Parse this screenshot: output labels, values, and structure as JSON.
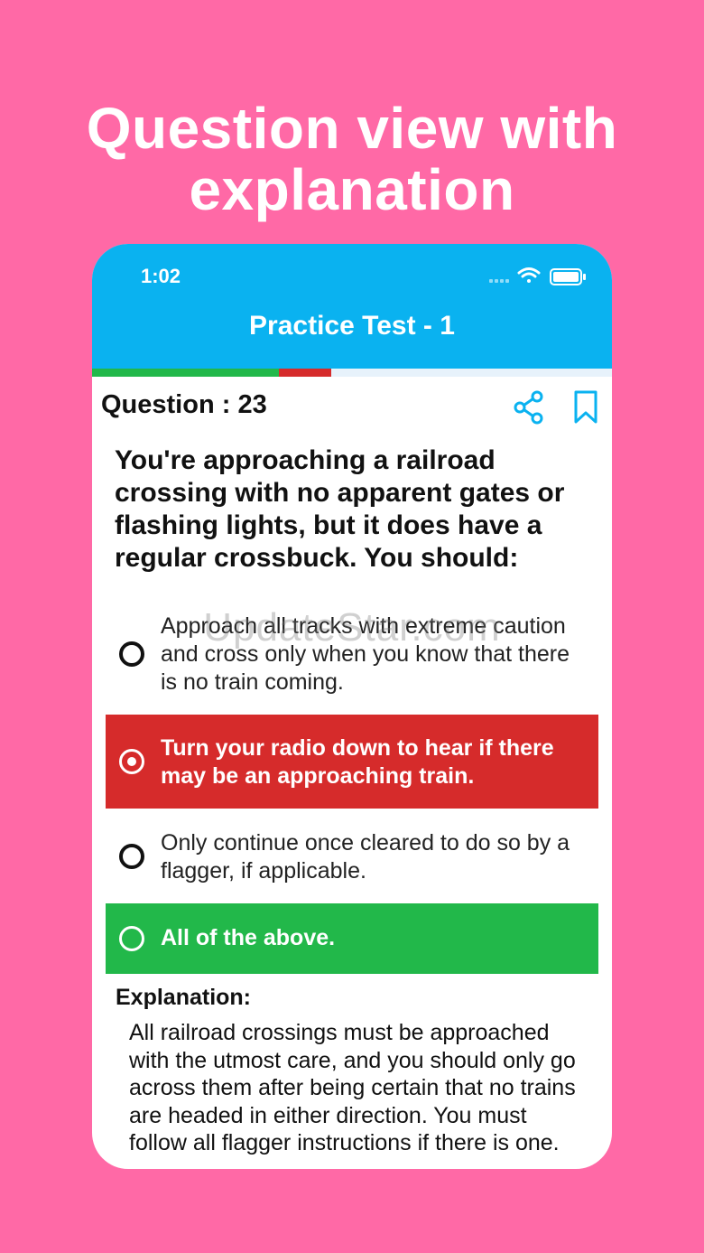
{
  "headline": [
    "Question view with",
    "explanation"
  ],
  "status_bar": {
    "time": "1:02"
  },
  "header": {
    "title": "Practice Test - 1"
  },
  "colors": {
    "accent": "#0ab2f0",
    "correct": "#22b84a",
    "wrong": "#d62b2b",
    "background": "#ff69a6"
  },
  "question": {
    "number_label": "Question : 23",
    "text": "You're approaching a railroad crossing with no apparent gates or flashing lights, but it does have a regular crossbuck. You should:"
  },
  "options": [
    {
      "text": "Approach all tracks with extreme caution and cross only when you know that there is no train coming.",
      "state": "none"
    },
    {
      "text": "Turn your radio down to hear if there may be an approaching train.",
      "state": "wrong-selected"
    },
    {
      "text": "Only continue once cleared to do so by a flagger, if applicable.",
      "state": "none"
    },
    {
      "text": "All of the above.",
      "state": "correct"
    }
  ],
  "explanation": {
    "title": "Explanation:",
    "text": "All railroad crossings must be approached with the utmost care, and you should only go across them after being certain that no trains are headed in either direction. You must follow all flagger instructions if there is one."
  },
  "watermark": "UpdateStar.com",
  "icons": {
    "share": "share-icon",
    "bookmark": "bookmark-icon",
    "wifi": "wifi-icon",
    "battery": "battery-icon"
  }
}
